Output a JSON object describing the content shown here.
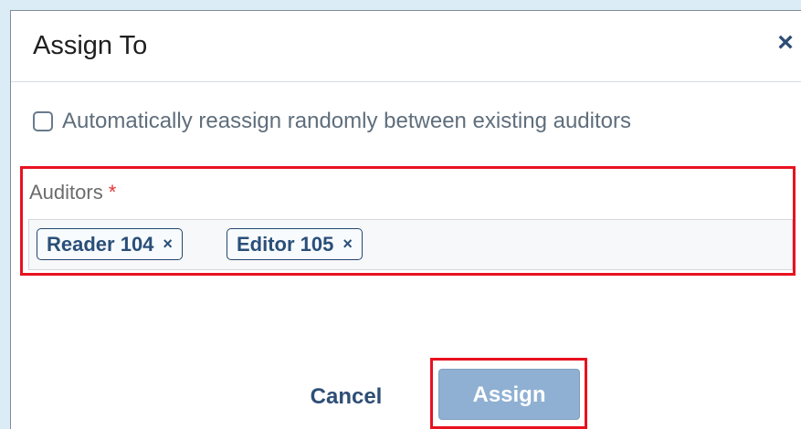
{
  "dialog": {
    "title": "Assign To",
    "close_icon": "×"
  },
  "auto_reassign": {
    "checked": false,
    "label": "Automatically reassign randomly between existing auditors"
  },
  "auditors": {
    "label": "Auditors",
    "required_marker": "*",
    "tags": [
      {
        "label": "Reader 104",
        "remove_icon": "×"
      },
      {
        "label": "Editor 105",
        "remove_icon": "×"
      }
    ]
  },
  "actions": {
    "cancel_label": "Cancel",
    "assign_label": "Assign",
    "assign_disabled": true
  },
  "colors": {
    "dialog_background": "#ffffff",
    "page_background": "#dcecf7",
    "highlight_border": "#e8121f",
    "primary_text": "#2a4f79",
    "assign_button": "#8fb0d2"
  }
}
